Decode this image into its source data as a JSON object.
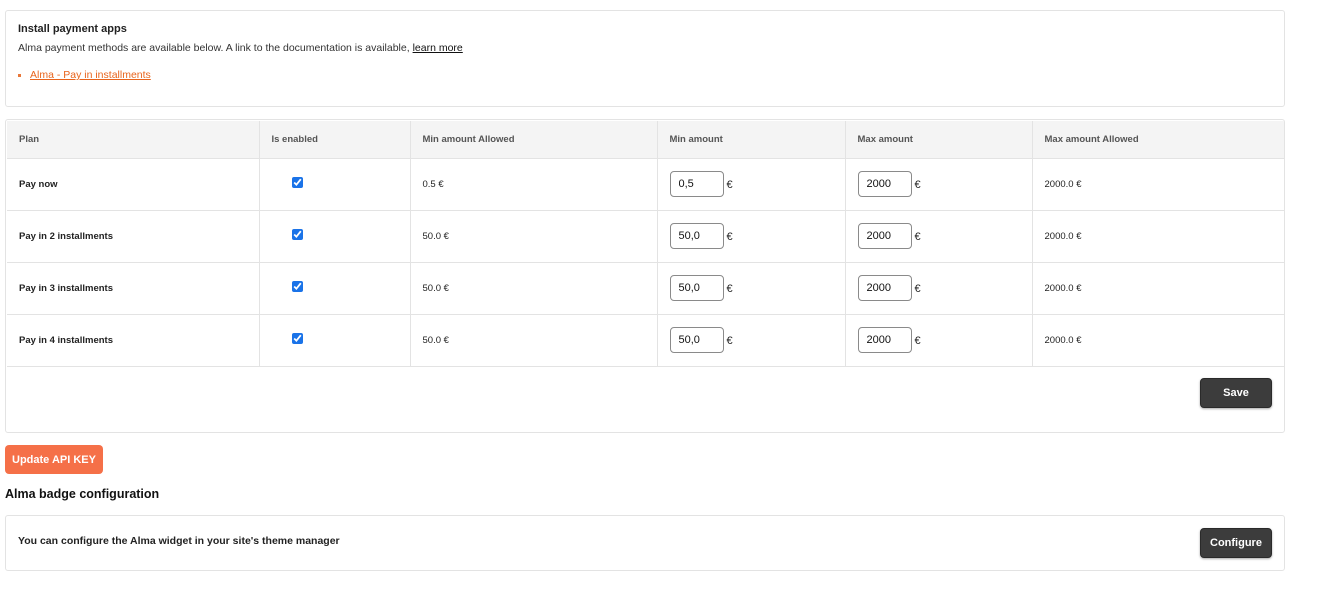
{
  "install": {
    "title": "Install payment apps",
    "description": "Alma payment methods are available below. A link to the documentation is available, ",
    "learn_more": "learn more",
    "apps": [
      "Alma - Pay in installments"
    ]
  },
  "plans_table": {
    "headers": [
      "Plan",
      "Is enabled",
      "Min amount Allowed",
      "Min amount",
      "Max amount",
      "Max amount Allowed"
    ],
    "rows": [
      {
        "plan": "Pay now",
        "enabled": true,
        "min_allowed": "0.5 €",
        "min_amount": "0,5",
        "max_amount": "2000",
        "max_allowed": "2000.0 €"
      },
      {
        "plan": "Pay in 2 installments",
        "enabled": true,
        "min_allowed": "50.0 €",
        "min_amount": "50,0",
        "max_amount": "2000",
        "max_allowed": "2000.0 €"
      },
      {
        "plan": "Pay in 3 installments",
        "enabled": true,
        "min_allowed": "50.0 €",
        "min_amount": "50,0",
        "max_amount": "2000",
        "max_allowed": "2000.0 €"
      },
      {
        "plan": "Pay in 4 installments",
        "enabled": true,
        "min_allowed": "50.0 €",
        "min_amount": "50,0",
        "max_amount": "2000",
        "max_allowed": "2000.0 €"
      }
    ],
    "currency": "€",
    "save_label": "Save"
  },
  "update_api_key_label": "Update API KEY",
  "badge": {
    "title": "Alma badge configuration",
    "text": "You can configure the Alma widget in your site's theme manager",
    "configure_label": "Configure"
  },
  "colors": {
    "accent_orange": "#f57048",
    "link_orange": "#e8641c",
    "dark_button": "#3c3c3c",
    "checkbox_blue": "#1a73e8"
  }
}
